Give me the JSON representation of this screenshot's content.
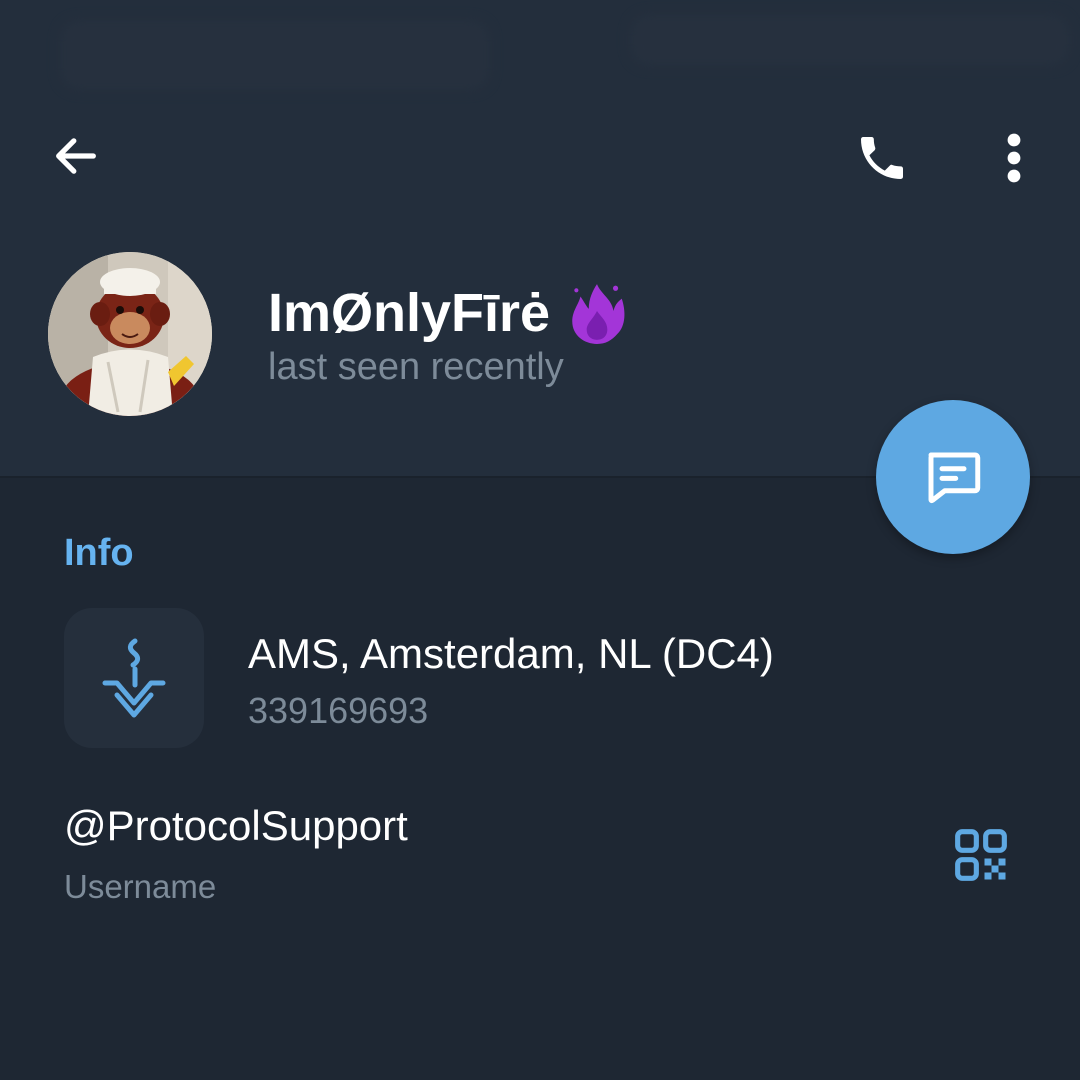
{
  "colors": {
    "header_bg": "#232e3c",
    "page_bg": "#1e2733",
    "accent": "#66b3f0",
    "fab": "#5ea8e2",
    "secondary_text": "#7d8b99",
    "emoji": "#a335d8"
  },
  "toolbar": {
    "back_icon": "arrow-left-icon",
    "call_icon": "phone-icon",
    "more_icon": "more-vertical-icon"
  },
  "profile": {
    "name": "ImØnlyFīrė",
    "status": "last seen recently",
    "badge_icon": "purple-fire-icon",
    "avatar_icon": "monkey-chef-avatar"
  },
  "fab": {
    "icon": "message-icon"
  },
  "info": {
    "section_title": "Info",
    "datacenter": {
      "icon": "datacenter-icon",
      "title": "AMS, Amsterdam, NL (DC4)",
      "id": "339169693"
    },
    "username": {
      "value": "@ProtocolSupport",
      "label": "Username",
      "qr_icon": "qr-code-icon"
    }
  }
}
